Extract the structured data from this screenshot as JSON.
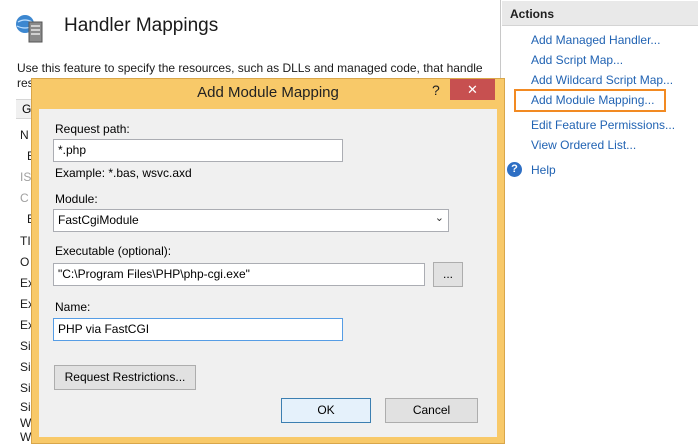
{
  "feature": {
    "title": "Handler Mappings",
    "description": "Use this feature to specify the resources, such as DLLs and managed code, that handle",
    "description_cont": "res",
    "column_header": "G",
    "list_letters": [
      "N",
      "E",
      "IS",
      "C",
      "E",
      "TI",
      "O",
      "Ex",
      "Ex",
      "Ex",
      "Si",
      "Si",
      "Si",
      "Si",
      "W",
      "W"
    ]
  },
  "actions": {
    "header": "Actions",
    "links": [
      "Add Managed Handler...",
      "Add Script Map...",
      "Add Wildcard Script Map...",
      "Add Module Mapping...",
      "Edit Feature Permissions...",
      "View Ordered List..."
    ],
    "help": "Help"
  },
  "dialog": {
    "title": "Add Module Mapping",
    "help_glyph": "?",
    "close_glyph": "✕",
    "request_path_label": "Request path:",
    "request_path_value": "*.php",
    "example_text": "Example: *.bas, wsvc.axd",
    "module_label": "Module:",
    "module_value": "FastCgiModule",
    "executable_label": "Executable (optional):",
    "executable_value": "\"C:\\Program Files\\PHP\\php-cgi.exe\"",
    "browse_label": "...",
    "name_label": "Name:",
    "name_value": "PHP via FastCGI",
    "restrictions_button": "Request Restrictions...",
    "ok_button": "OK",
    "cancel_button": "Cancel"
  },
  "colors": {
    "dialog_frame": "#f8c969",
    "close_button": "#c75050",
    "link": "#2163b3",
    "highlight": "#f28a22"
  }
}
